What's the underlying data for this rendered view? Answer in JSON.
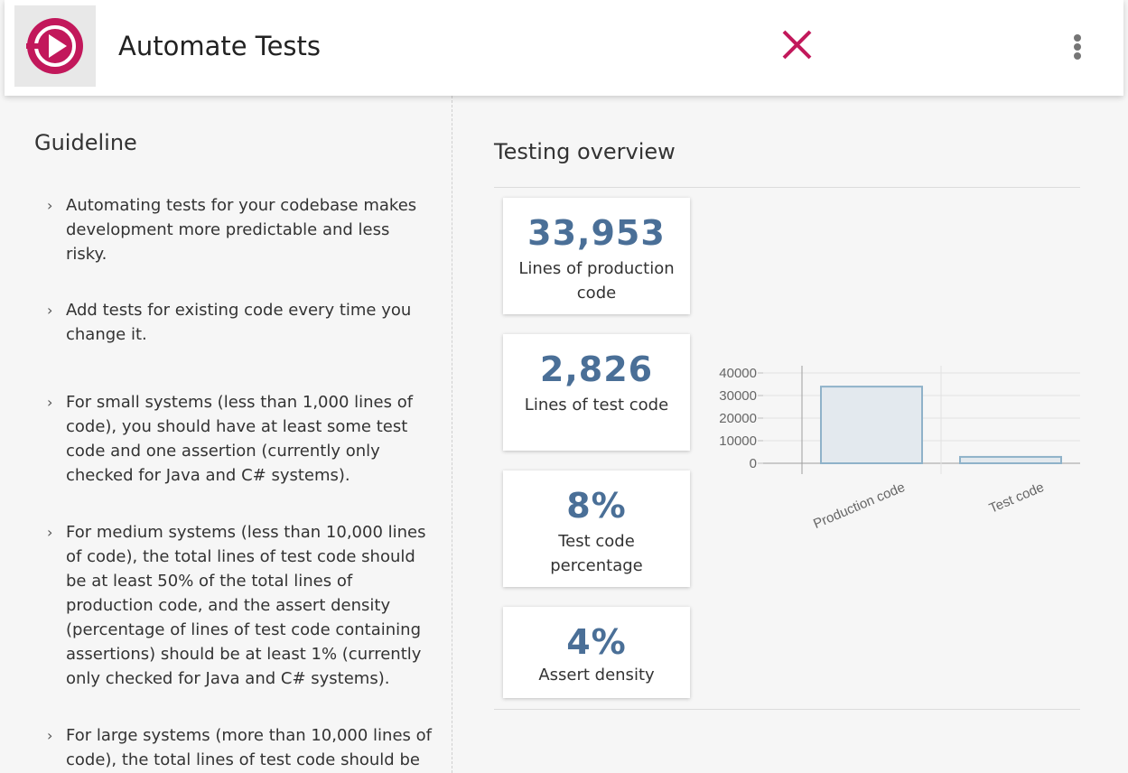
{
  "header": {
    "title": "Automate Tests",
    "logo_icon": "play-circle-logo-icon",
    "close_icon": "close-icon",
    "menu_icon": "more-vertical-icon",
    "accent_color": "#c2185b"
  },
  "guideline": {
    "title": "Guideline",
    "items": [
      "Automating tests for your codebase makes development more predictable and less risky.",
      "Add tests for existing code every time you change it.",
      "For small systems (less than 1,000 lines of code), you should have at least some test code and one assertion (currently only checked for Java and C# systems).",
      "For medium systems (less than 10,000 lines of code), the total lines of test code should be at least 50% of the total lines of production code, and the assert density (percentage of lines of test code containing assertions) should be at least 1% (currently only checked for Java and C# systems).",
      "For large systems (more than 10,000 lines of code), the total lines of test code should be"
    ]
  },
  "overview": {
    "title": "Testing overview",
    "metrics": [
      {
        "value": "33,953",
        "label": "Lines of production code"
      },
      {
        "value": "2,826",
        "label": "Lines of test code"
      },
      {
        "value": "8%",
        "label": "Test code percentage"
      },
      {
        "value": "4%",
        "label": "Assert density"
      }
    ],
    "number_color": "#4a6f97"
  },
  "chart_data": {
    "type": "bar",
    "categories": [
      "Production code",
      "Test code"
    ],
    "values": [
      33953,
      2826
    ],
    "ylim": [
      0,
      40000
    ],
    "yticks": [
      "40000",
      "30000",
      "20000",
      "10000",
      "0"
    ],
    "grid": true,
    "bar_fill": "#e3e9ee",
    "bar_stroke": "#8fb2c9"
  }
}
